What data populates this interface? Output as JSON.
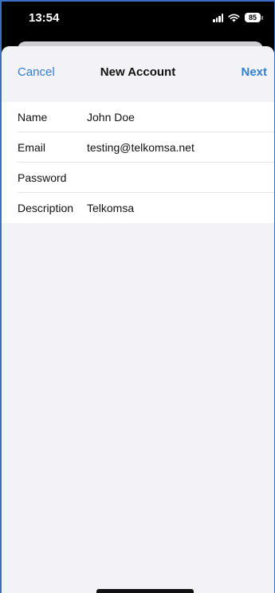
{
  "status_bar": {
    "time": "13:54",
    "battery": "85",
    "icons": [
      "signal-icon",
      "wifi-icon",
      "battery-icon"
    ]
  },
  "nav": {
    "cancel_label": "Cancel",
    "title": "New Account",
    "next_label": "Next"
  },
  "form": {
    "fields": [
      {
        "label": "Name",
        "value": "John Doe"
      },
      {
        "label": "Email",
        "value": "testing@telkomsa.net"
      },
      {
        "label": "Password",
        "value": ""
      },
      {
        "label": "Description",
        "value": "Telkomsa"
      }
    ]
  },
  "colors": {
    "accent": "#2f7fd1",
    "background": "#f2f2f7",
    "form_background": "#ffffff"
  }
}
